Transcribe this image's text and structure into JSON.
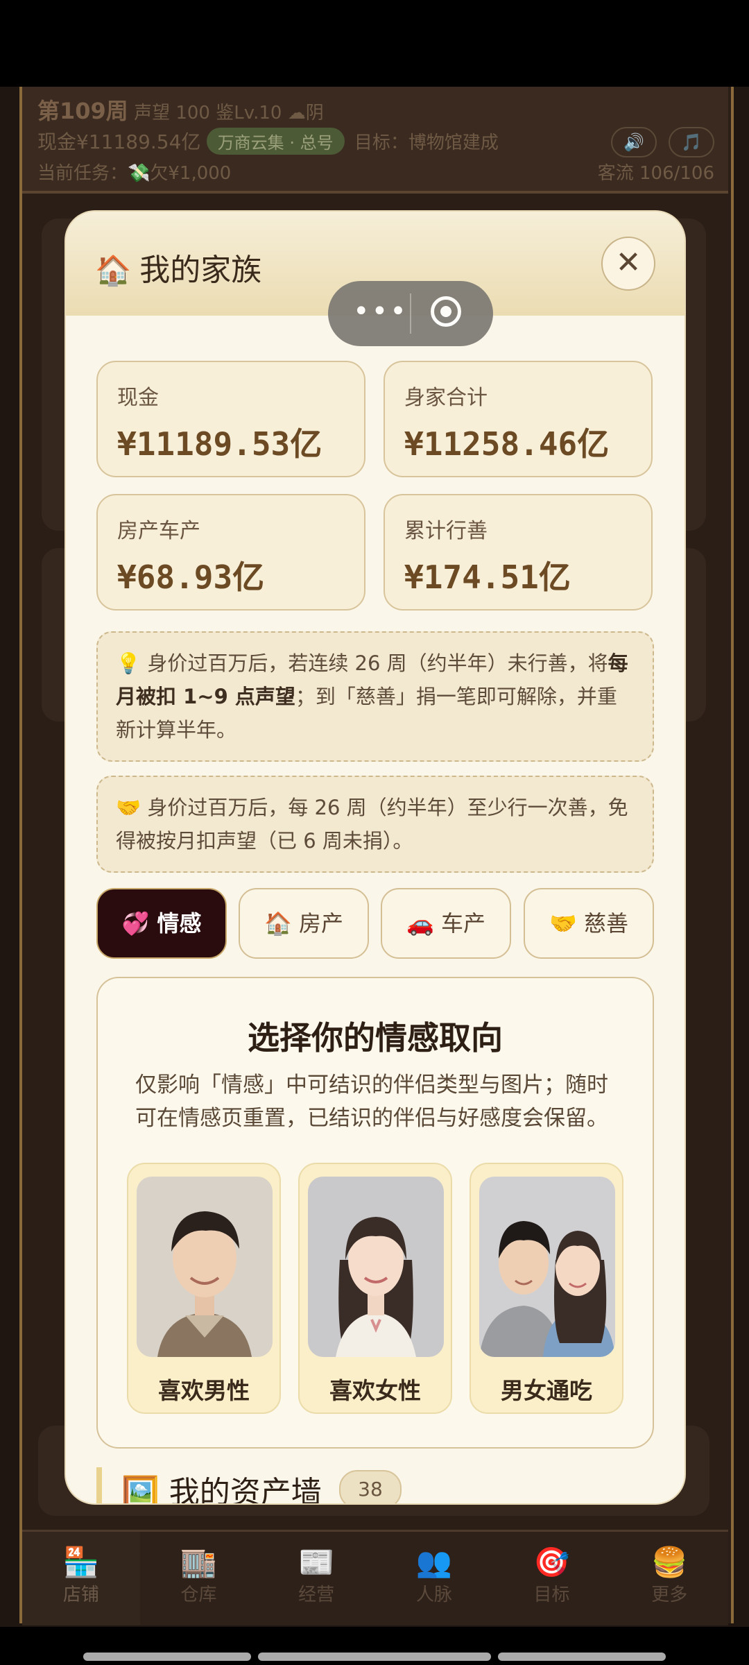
{
  "topbar": {
    "week": "第109周",
    "reputation": "声望 100",
    "level": "鉴Lv.10",
    "weather": "☁阴",
    "cash": "现金¥11189.54亿",
    "shop_tag": "万商云集 · 总号",
    "goal": "目标：博物馆建成",
    "task": "当前任务：💸欠¥1,000",
    "traffic": "客流 106/106",
    "sound_icon": "🔊",
    "music_icon": "🎵"
  },
  "bottom_nav": [
    {
      "icon": "🏪",
      "label": "店铺"
    },
    {
      "icon": "🏬",
      "label": "仓库"
    },
    {
      "icon": "📰",
      "label": "经营"
    },
    {
      "icon": "👥",
      "label": "人脉"
    },
    {
      "icon": "🎯",
      "label": "目标"
    },
    {
      "icon": "🍔",
      "label": "更多"
    }
  ],
  "modal": {
    "title_icon": "🏠",
    "title": "我的家族",
    "close": "✕",
    "capsule_dots": "•••",
    "stats": [
      {
        "label": "现金",
        "value": "¥11189.53亿"
      },
      {
        "label": "身家合计",
        "value": "¥11258.46亿"
      },
      {
        "label": "房产车产",
        "value": "¥68.93亿"
      },
      {
        "label": "累计行善",
        "value": "¥174.51亿"
      }
    ],
    "notice1": {
      "icon": "💡",
      "pre": "身价过百万后，若连续 26 周（约半年）未行善，将",
      "bold": "每月被扣 1~9 点声望",
      "post": "；到「慈善」捐一笔即可解除，并重新计算半年。"
    },
    "notice2": {
      "icon": "🤝",
      "text": "身价过百万后，每 26 周（约半年）至少行一次善，免得被按月扣声望（已 6 周未捐）。"
    },
    "tabs": [
      {
        "icon": "💞",
        "label": "情感"
      },
      {
        "icon": "🏠",
        "label": "房产"
      },
      {
        "icon": "🚗",
        "label": "车产"
      },
      {
        "icon": "🤝",
        "label": "慈善"
      }
    ],
    "orientation": {
      "title": "选择你的情感取向",
      "desc": "仅影响「情感」中可结识的伴侣类型与图片；随时可在情感页重置，已结识的伴侣与好感度会保留。",
      "options": [
        "喜欢男性",
        "喜欢女性",
        "男女通吃"
      ]
    },
    "asset_wall": {
      "icon": "🖼️",
      "title": "我的资产墙",
      "count": "38"
    }
  }
}
